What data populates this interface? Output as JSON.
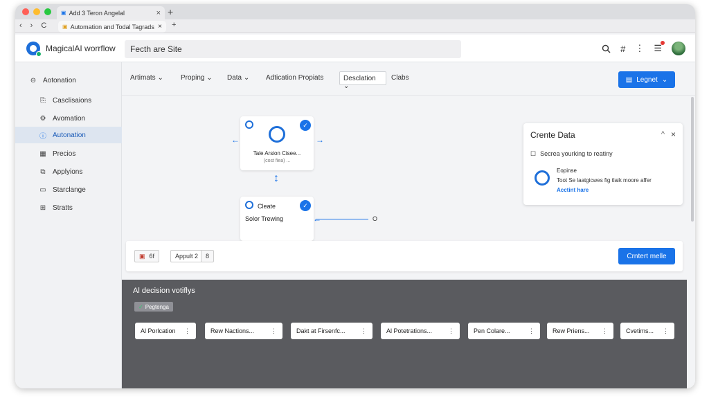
{
  "browser": {
    "tab1_title": "Add 3 Teron Angelal",
    "tab2_title": "Automation and Todal Tagrads",
    "close": "×",
    "new_tab": "+",
    "back": "‹",
    "forward": "›",
    "reload": "C"
  },
  "header": {
    "app_title": "MagicalAI worrflow",
    "search_value": "Fecth are Site",
    "icons": [
      "search-icon",
      "hash-icon",
      "more-icon",
      "notes-icon",
      "avatar"
    ]
  },
  "sidebar": {
    "items": [
      {
        "label": "Aotonation",
        "icon": "compass-icon"
      },
      {
        "label": "Casclisaions",
        "icon": "doc-icon"
      },
      {
        "label": "Avomation",
        "icon": "gear-icon"
      },
      {
        "label": "Autonation",
        "icon": "info-icon",
        "active": true
      },
      {
        "label": "Precios",
        "icon": "grid-icon"
      },
      {
        "label": "Applyions",
        "icon": "copy-icon"
      },
      {
        "label": "Starclange",
        "icon": "monitor-icon"
      },
      {
        "label": "Stratts",
        "icon": "grid-icon"
      }
    ]
  },
  "toolbar": {
    "items": [
      "Artimats",
      "Proping",
      "Data",
      "Adtication Propiats"
    ],
    "chevron": "⌄",
    "select_value": "Desclation",
    "trailing": "Clabs",
    "button": "Legnet"
  },
  "canvas": {
    "node1_label": "Tale Arsion Cisee...",
    "node1_sub": "(cost fiea) ...",
    "node2_title": "Cleate",
    "node2_label": "Solor Trewing",
    "connector_end": "O"
  },
  "panel": {
    "title": "Crente Data",
    "row1": "Secrea yourking to reatiny",
    "item_title": "Eopinse",
    "item_text": "Toot Se laatgicwes fig tlaik moore affer",
    "item_link": "Acctint hare",
    "collapse": "^",
    "close": "×"
  },
  "bottombar": {
    "chip1_count": "6f",
    "chip2": "Appult 2",
    "chip3": "8",
    "button": "Crntert melle"
  },
  "dark_section": {
    "title": "Al decision votiflys",
    "tag": "Pegtenga",
    "cards": [
      "Al Porlcation",
      "Rew Nactions...",
      "Dakt at Firsenfc...",
      "Al Potetrations...",
      "Pen Colare...",
      "Rew Priens...",
      "Cvetims..."
    ],
    "card_menu": "⋮"
  },
  "colors": {
    "accent": "#1a73e8",
    "sidebar_active": "#dde5f0",
    "dark_panel": "#5a5b5f"
  }
}
